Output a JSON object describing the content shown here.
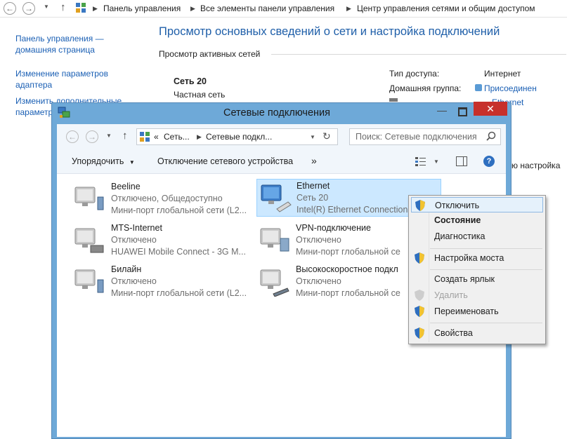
{
  "breadcrumb": {
    "items": [
      "Панель управления",
      "Все элементы панели управления",
      "Центр управления сетями и общим доступом"
    ]
  },
  "sidebar": {
    "home_line1": "Панель управления —",
    "home_line2": "домашняя страница",
    "adapter_line1": "Изменение параметров",
    "adapter_line2": "адаптера",
    "sharing_line1": "Изменить дополнительные",
    "sharing_line2": "параметры"
  },
  "main": {
    "heading": "Просмотр основных сведений о сети и настройка подключений",
    "active_networks": "Просмотр активных сетей",
    "network_name": "Сеть  20",
    "network_type": "Частная сеть",
    "access_label": "Тип доступа:",
    "access_value": "Интернет",
    "homegroup_label": "Домашняя группа:",
    "homegroup_value": "Присоединен",
    "conn_value": "Ethernet",
    "partial_setup": "ю настройка"
  },
  "window": {
    "title": "Сетевые подключения",
    "address_crumbs": [
      "Сеть...",
      "Сетевые подкл..."
    ],
    "address_prefix": "«",
    "search_placeholder": "Поиск: Сетевые подключения",
    "organize": "Упорядочить",
    "disable_device": "Отключение сетевого устройства",
    "more": "»"
  },
  "connections": [
    {
      "name": "Beeline",
      "status": "Отключено, Общедоступно",
      "device": "Мини-порт глобальной сети (L2..."
    },
    {
      "name": "Ethernet",
      "status": "Сеть  20",
      "device": "Intel(R) Ethernet Connection"
    },
    {
      "name": "MTS-Internet",
      "status": "Отключено",
      "device": "HUAWEI Mobile Connect - 3G M..."
    },
    {
      "name": "VPN-подключение",
      "status": "Отключено",
      "device": "Мини-порт глобальной се"
    },
    {
      "name": "Билайн",
      "status": "Отключено",
      "device": "Мини-порт глобальной сети (L2..."
    },
    {
      "name": "Высокоскоростное подкл",
      "status": "Отключено",
      "device": "Мини-порт глобальной се"
    }
  ],
  "context_menu": {
    "disable": "Отключить",
    "status": "Состояние",
    "diagnostics": "Диагностика",
    "bridge": "Настройка моста",
    "shortcut": "Создать ярлык",
    "delete": "Удалить",
    "rename": "Переименовать",
    "properties": "Свойства"
  },
  "colors": {
    "accent": "#1f5fa9",
    "window_frame": "#6ea9d8",
    "close": "#c7302b",
    "selection": "#cce8ff"
  }
}
